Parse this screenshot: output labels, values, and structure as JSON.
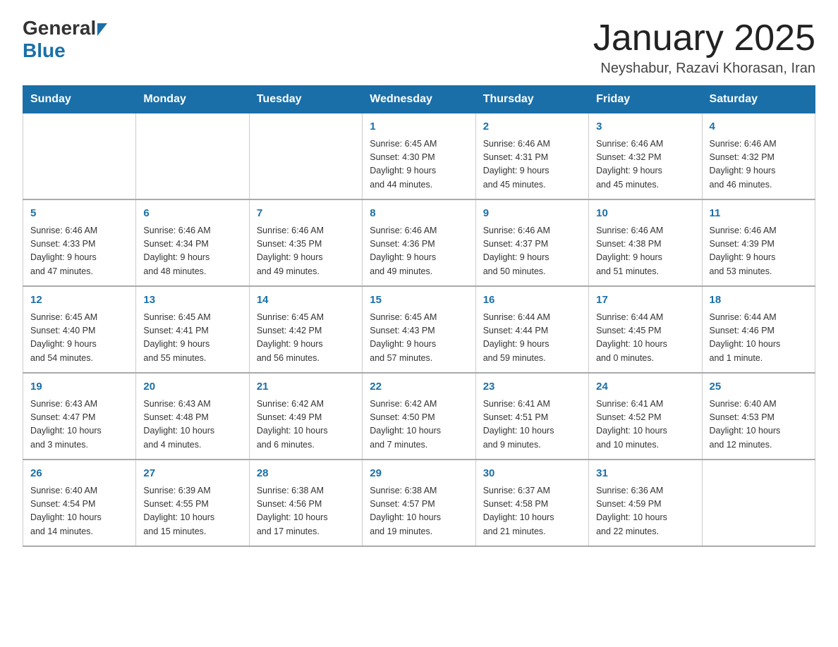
{
  "header": {
    "logo_general": "General",
    "logo_blue": "Blue",
    "title": "January 2025",
    "subtitle": "Neyshabur, Razavi Khorasan, Iran"
  },
  "days_of_week": [
    "Sunday",
    "Monday",
    "Tuesday",
    "Wednesday",
    "Thursday",
    "Friday",
    "Saturday"
  ],
  "weeks": [
    [
      {
        "day": "",
        "info": ""
      },
      {
        "day": "",
        "info": ""
      },
      {
        "day": "",
        "info": ""
      },
      {
        "day": "1",
        "info": "Sunrise: 6:45 AM\nSunset: 4:30 PM\nDaylight: 9 hours\nand 44 minutes."
      },
      {
        "day": "2",
        "info": "Sunrise: 6:46 AM\nSunset: 4:31 PM\nDaylight: 9 hours\nand 45 minutes."
      },
      {
        "day": "3",
        "info": "Sunrise: 6:46 AM\nSunset: 4:32 PM\nDaylight: 9 hours\nand 45 minutes."
      },
      {
        "day": "4",
        "info": "Sunrise: 6:46 AM\nSunset: 4:32 PM\nDaylight: 9 hours\nand 46 minutes."
      }
    ],
    [
      {
        "day": "5",
        "info": "Sunrise: 6:46 AM\nSunset: 4:33 PM\nDaylight: 9 hours\nand 47 minutes."
      },
      {
        "day": "6",
        "info": "Sunrise: 6:46 AM\nSunset: 4:34 PM\nDaylight: 9 hours\nand 48 minutes."
      },
      {
        "day": "7",
        "info": "Sunrise: 6:46 AM\nSunset: 4:35 PM\nDaylight: 9 hours\nand 49 minutes."
      },
      {
        "day": "8",
        "info": "Sunrise: 6:46 AM\nSunset: 4:36 PM\nDaylight: 9 hours\nand 49 minutes."
      },
      {
        "day": "9",
        "info": "Sunrise: 6:46 AM\nSunset: 4:37 PM\nDaylight: 9 hours\nand 50 minutes."
      },
      {
        "day": "10",
        "info": "Sunrise: 6:46 AM\nSunset: 4:38 PM\nDaylight: 9 hours\nand 51 minutes."
      },
      {
        "day": "11",
        "info": "Sunrise: 6:46 AM\nSunset: 4:39 PM\nDaylight: 9 hours\nand 53 minutes."
      }
    ],
    [
      {
        "day": "12",
        "info": "Sunrise: 6:45 AM\nSunset: 4:40 PM\nDaylight: 9 hours\nand 54 minutes."
      },
      {
        "day": "13",
        "info": "Sunrise: 6:45 AM\nSunset: 4:41 PM\nDaylight: 9 hours\nand 55 minutes."
      },
      {
        "day": "14",
        "info": "Sunrise: 6:45 AM\nSunset: 4:42 PM\nDaylight: 9 hours\nand 56 minutes."
      },
      {
        "day": "15",
        "info": "Sunrise: 6:45 AM\nSunset: 4:43 PM\nDaylight: 9 hours\nand 57 minutes."
      },
      {
        "day": "16",
        "info": "Sunrise: 6:44 AM\nSunset: 4:44 PM\nDaylight: 9 hours\nand 59 minutes."
      },
      {
        "day": "17",
        "info": "Sunrise: 6:44 AM\nSunset: 4:45 PM\nDaylight: 10 hours\nand 0 minutes."
      },
      {
        "day": "18",
        "info": "Sunrise: 6:44 AM\nSunset: 4:46 PM\nDaylight: 10 hours\nand 1 minute."
      }
    ],
    [
      {
        "day": "19",
        "info": "Sunrise: 6:43 AM\nSunset: 4:47 PM\nDaylight: 10 hours\nand 3 minutes."
      },
      {
        "day": "20",
        "info": "Sunrise: 6:43 AM\nSunset: 4:48 PM\nDaylight: 10 hours\nand 4 minutes."
      },
      {
        "day": "21",
        "info": "Sunrise: 6:42 AM\nSunset: 4:49 PM\nDaylight: 10 hours\nand 6 minutes."
      },
      {
        "day": "22",
        "info": "Sunrise: 6:42 AM\nSunset: 4:50 PM\nDaylight: 10 hours\nand 7 minutes."
      },
      {
        "day": "23",
        "info": "Sunrise: 6:41 AM\nSunset: 4:51 PM\nDaylight: 10 hours\nand 9 minutes."
      },
      {
        "day": "24",
        "info": "Sunrise: 6:41 AM\nSunset: 4:52 PM\nDaylight: 10 hours\nand 10 minutes."
      },
      {
        "day": "25",
        "info": "Sunrise: 6:40 AM\nSunset: 4:53 PM\nDaylight: 10 hours\nand 12 minutes."
      }
    ],
    [
      {
        "day": "26",
        "info": "Sunrise: 6:40 AM\nSunset: 4:54 PM\nDaylight: 10 hours\nand 14 minutes."
      },
      {
        "day": "27",
        "info": "Sunrise: 6:39 AM\nSunset: 4:55 PM\nDaylight: 10 hours\nand 15 minutes."
      },
      {
        "day": "28",
        "info": "Sunrise: 6:38 AM\nSunset: 4:56 PM\nDaylight: 10 hours\nand 17 minutes."
      },
      {
        "day": "29",
        "info": "Sunrise: 6:38 AM\nSunset: 4:57 PM\nDaylight: 10 hours\nand 19 minutes."
      },
      {
        "day": "30",
        "info": "Sunrise: 6:37 AM\nSunset: 4:58 PM\nDaylight: 10 hours\nand 21 minutes."
      },
      {
        "day": "31",
        "info": "Sunrise: 6:36 AM\nSunset: 4:59 PM\nDaylight: 10 hours\nand 22 minutes."
      },
      {
        "day": "",
        "info": ""
      }
    ]
  ]
}
